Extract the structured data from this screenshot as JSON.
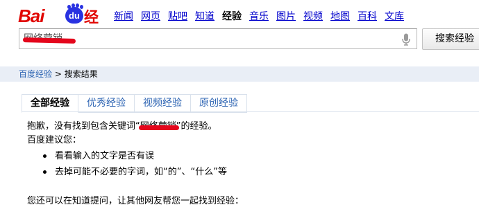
{
  "logo": {
    "bai": "Bai",
    "du": "du",
    "jingyan": "经验"
  },
  "nav": {
    "items": [
      "新闻",
      "网页",
      "贴吧",
      "知道",
      "经验",
      "音乐",
      "图片",
      "视频",
      "地图",
      "百科",
      "文库"
    ],
    "current_index": 4
  },
  "search": {
    "value": "网络营销",
    "button_label": "搜索经验"
  },
  "breadcrumb": {
    "home": "百度经验",
    "separator": " > ",
    "current": "搜索结果"
  },
  "tabs": {
    "items": [
      "全部经验",
      "优秀经验",
      "视频经验",
      "原创经验"
    ],
    "active_index": 0
  },
  "result": {
    "sorry_prefix": "抱歉，没有找到包含关键词“",
    "keyword": "网络营销",
    "sorry_suffix": "”的经验。",
    "suggest_title": "百度建议您：",
    "suggestions": [
      "看看输入的文字是否有误",
      "去掉可能不必要的字词，如“的”、“什么”等"
    ],
    "zhidao_hint": "您还可以在知道提问，让其他网友帮您一起找到经验："
  },
  "colors": {
    "brand_red": "#e10602",
    "brand_blue": "#2932e1",
    "link_blue": "#2d64b3",
    "nav_blue": "#0000cc",
    "redaction": "#e4061c"
  }
}
